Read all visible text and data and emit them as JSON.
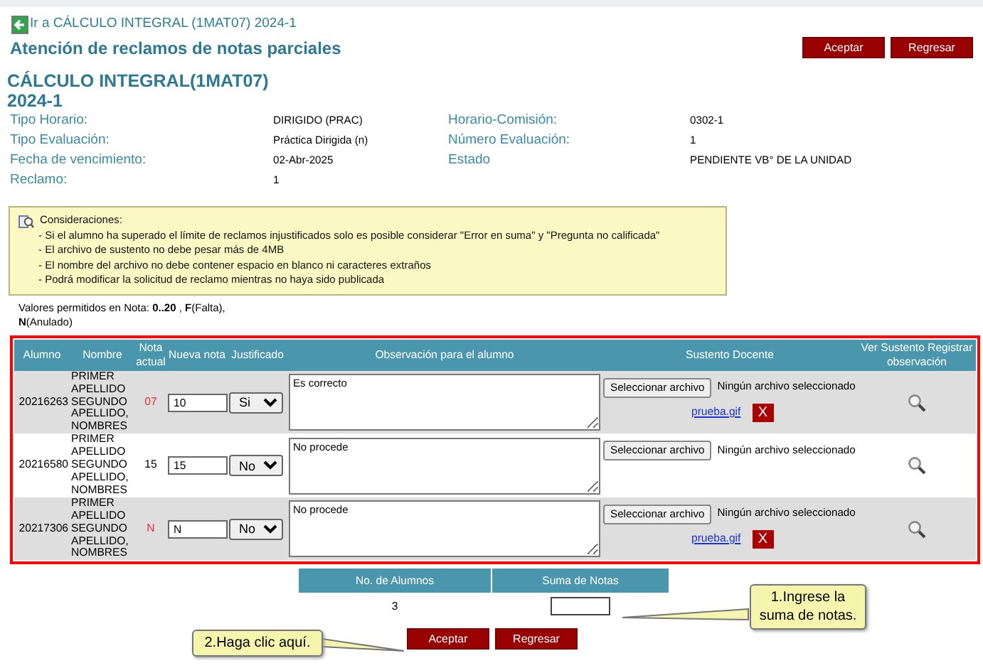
{
  "back_link": {
    "text": "Ir a CÁLCULO INTEGRAL (1MAT07) 2024-1"
  },
  "title": "Atención de reclamos de notas parciales",
  "header_buttons": [
    "Aceptar",
    "Regresar"
  ],
  "course": {
    "name": "CÁLCULO INTEGRAL(1MAT07)",
    "period": "2024-1"
  },
  "info": [
    {
      "label": "Tipo Horario:",
      "value": "DIRIGIDO (PRAC)"
    },
    {
      "label": "Horario-Comisión:",
      "value": "0302-1"
    },
    {
      "label": "Tipo Evaluación:",
      "value": "Práctica Dirigida (n)"
    },
    {
      "label": "Número Evaluación:",
      "value": "1"
    },
    {
      "label": "Fecha de vencimiento:",
      "value": "02-Abr-2025"
    },
    {
      "label": "Estado",
      "value": "PENDIENTE VB° DE LA UNIDAD"
    },
    {
      "label": "Reclamo:",
      "value": "1"
    }
  ],
  "considerations": {
    "title": "Consideraciones:",
    "items": [
      "- Si el alumno ha superado el límite de reclamos injustificados solo es posible considerar \"Error en suma\" y \"Pregunta no calificada\"",
      "- El archivo de sustento no debe pesar más de 4MB",
      "- El nombre del archivo no debe contener espacio en blanco ni caracteres extraños",
      "- Podrá modificar la solicitud de reclamo mientras no haya sido publicada"
    ]
  },
  "allowed_values": [
    "Valores permitidos en Nota: **0..20** , **F**(Falta),",
    "**N**(Anulado)"
  ],
  "table": {
    "columns": [
      "Alumno",
      "Nombre",
      "Nota actual",
      "Nueva nota",
      "Justificado",
      "Observación para el alumno",
      "Sustento Docente",
      "Ver Sustento Registrar observación"
    ],
    "rows": [
      {
        "alumno": "20216263",
        "nombre": "PRIMER APELLIDO SEGUNDO APELLIDO, NOMBRES",
        "nota_actual": "07",
        "alert": true,
        "nueva_nota": "10",
        "justificado": "Si",
        "observacion": "Es correcto",
        "file_button": "Seleccionar archivo",
        "file_status": "Ningún archivo seleccionado",
        "attachment": "prueba.gif",
        "delete": "X"
      },
      {
        "alumno": "20216580",
        "nombre": "PRIMER APELLIDO SEGUNDO APELLIDO, NOMBRES",
        "nota_actual": "15",
        "alert": false,
        "nueva_nota": "15",
        "justificado": "No",
        "observacion": "No procede",
        "file_button": "Seleccionar archivo",
        "file_status": "Ningún archivo seleccionado"
      },
      {
        "alumno": "20217306",
        "nombre": "PRIMER APELLIDO SEGUNDO APELLIDO, NOMBRES",
        "nota_actual": "N",
        "alert": true,
        "nueva_nota": "N",
        "justificado": "No",
        "observacion": "No procede",
        "file_button": "Seleccionar archivo",
        "file_status": "Ningún archivo seleccionado",
        "attachment": "prueba.gif",
        "delete": "X"
      }
    ]
  },
  "summary": {
    "columns": [
      "No. de Alumnos",
      "Suma de Notas"
    ],
    "count": "3"
  },
  "callouts": [
    "1.Ingrese la suma de notas.",
    "2.Haga clic aquí."
  ],
  "bottom_buttons": [
    "Aceptar",
    "Regresar"
  ]
}
